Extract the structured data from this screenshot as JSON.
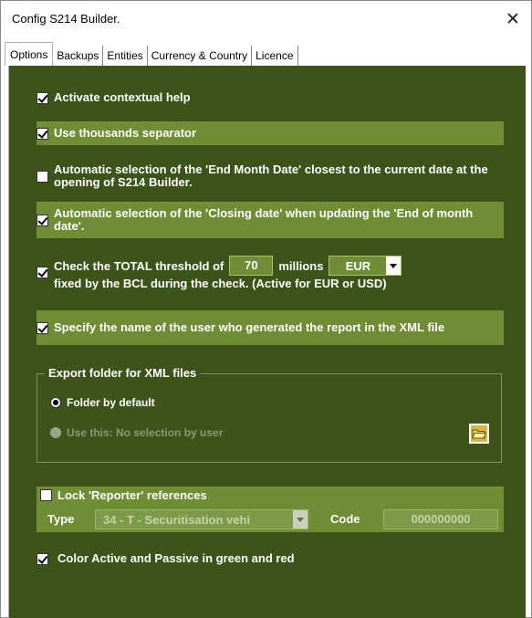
{
  "window": {
    "title": "Config S214 Builder."
  },
  "tabs": [
    {
      "label": "Options",
      "active": true
    },
    {
      "label": "Backups",
      "active": false
    },
    {
      "label": "Entities",
      "active": false
    },
    {
      "label": "Currency & Country",
      "active": false
    },
    {
      "label": "Licence",
      "active": false
    }
  ],
  "options": {
    "contextual_help": {
      "label": "Activate contextual help",
      "checked": true
    },
    "thousands_separator": {
      "label": "Use thousands separator",
      "checked": true
    },
    "end_month_date": {
      "label": "Automatic selection of the 'End Month Date' closest to the current date at the opening of S214 Builder.",
      "checked": false
    },
    "closing_date": {
      "label": "Automatic selection of the 'Closing date' when updating the 'End of month date'.",
      "checked": true
    },
    "threshold": {
      "checked": true,
      "label_part1": "Check the TOTAL threshold of",
      "value": "70",
      "label_part2": "millions",
      "currency": "EUR",
      "label_part3": "fixed by the BCL during the check. (Active for EUR or USD)"
    },
    "user_name": {
      "label": "Specify the name of the user who generated the report in the XML file",
      "checked": true
    }
  },
  "export_folder": {
    "title": "Export folder for XML files",
    "default_label": "Folder by default",
    "custom_label": "Use this: No selection by user",
    "selected": "default"
  },
  "reporter": {
    "lock_label": "Lock 'Reporter' references",
    "locked": false,
    "type_label": "Type",
    "type_value": "34 - T - Securitisation vehi",
    "code_label": "Code",
    "code_value": "000000000"
  },
  "colors": {
    "label": "Color Active and Passive in green and red",
    "checked": true,
    "panel_bg": "#3c5419",
    "band_bg": "#6e8d34"
  }
}
